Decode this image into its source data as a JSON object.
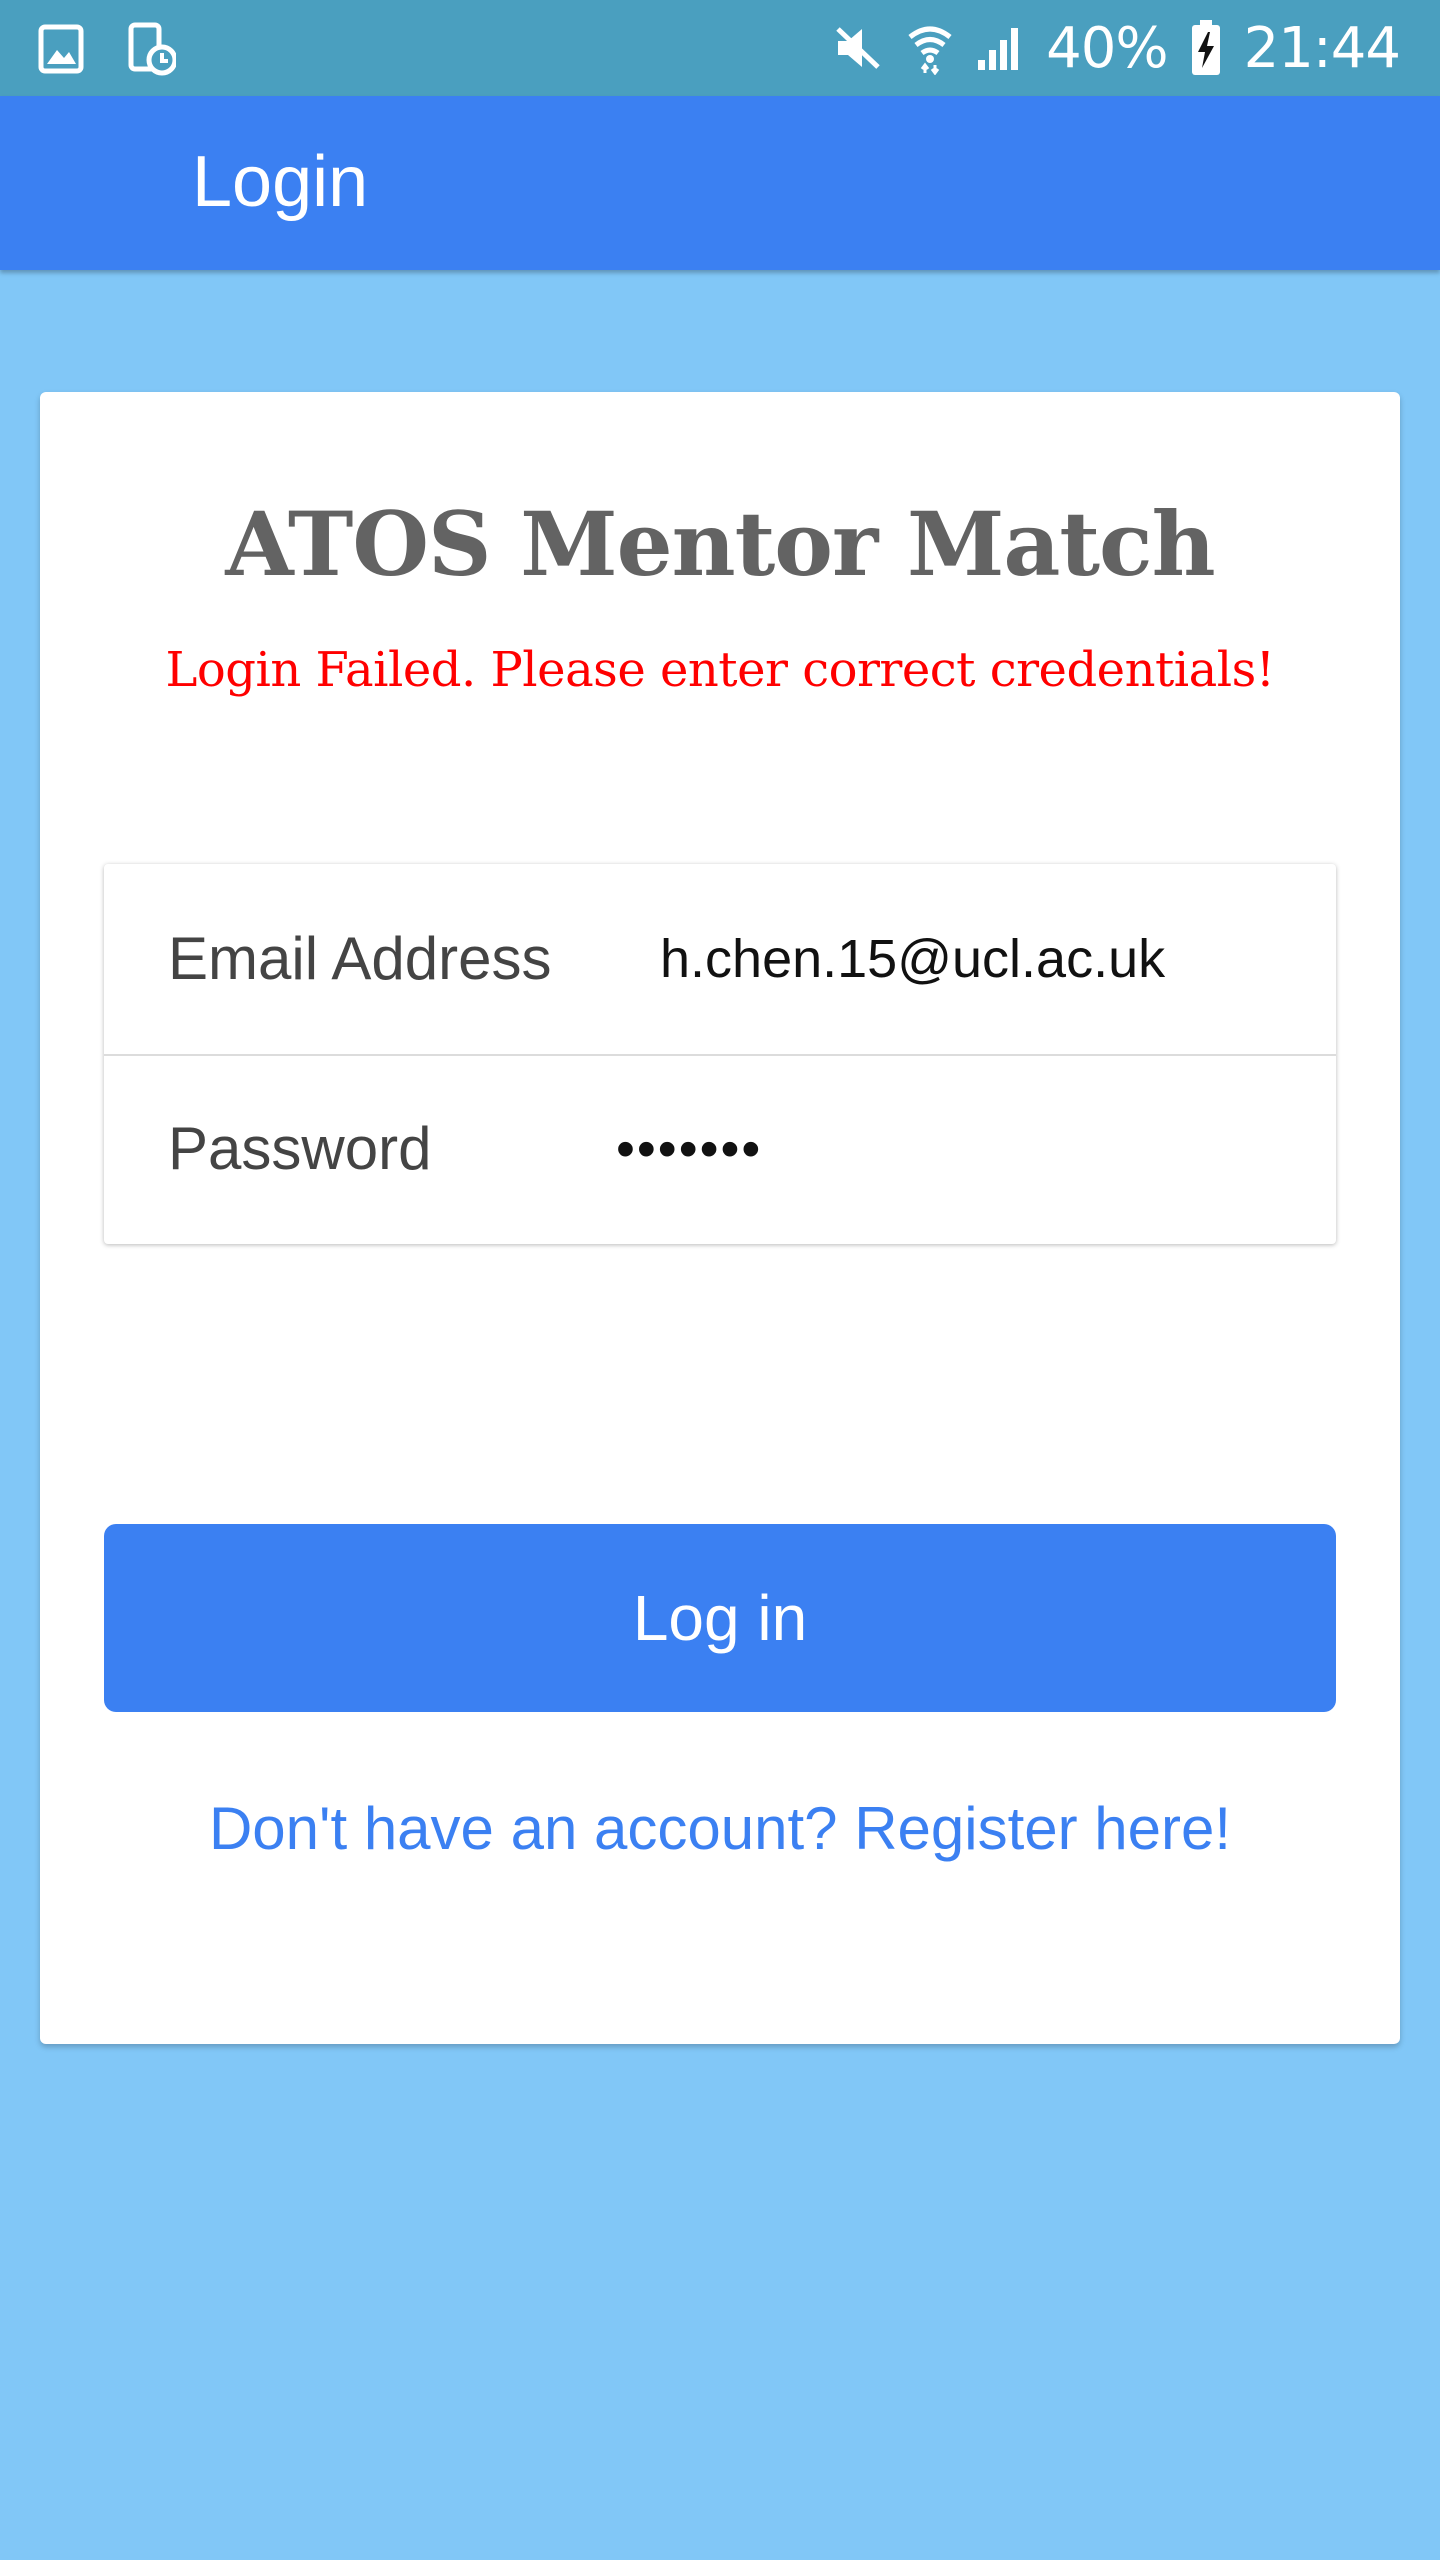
{
  "status_bar": {
    "battery_percent": "40%",
    "time": "21:44",
    "icons": [
      "gallery-icon",
      "screenshot-icon",
      "mute-icon",
      "wifi-icon",
      "signal-icon",
      "battery-charging-icon"
    ]
  },
  "app_bar": {
    "title": "Login"
  },
  "card": {
    "app_name": "ATOS Mentor Match",
    "error_message": "Login Failed. Please enter correct credentials!",
    "email": {
      "label": "Email Address",
      "value": "h.chen.15@ucl.ac.uk"
    },
    "password": {
      "label": "Password",
      "value": "•••••••"
    },
    "login_button": "Log in",
    "register_link": "Don't have an account? Register here!"
  },
  "colors": {
    "status_bar": "#4a9fbf",
    "app_bar": "#3b80f2",
    "background": "#81c7f7",
    "error": "#ff0000",
    "button": "#3b80f2",
    "link": "#3b80f2"
  }
}
